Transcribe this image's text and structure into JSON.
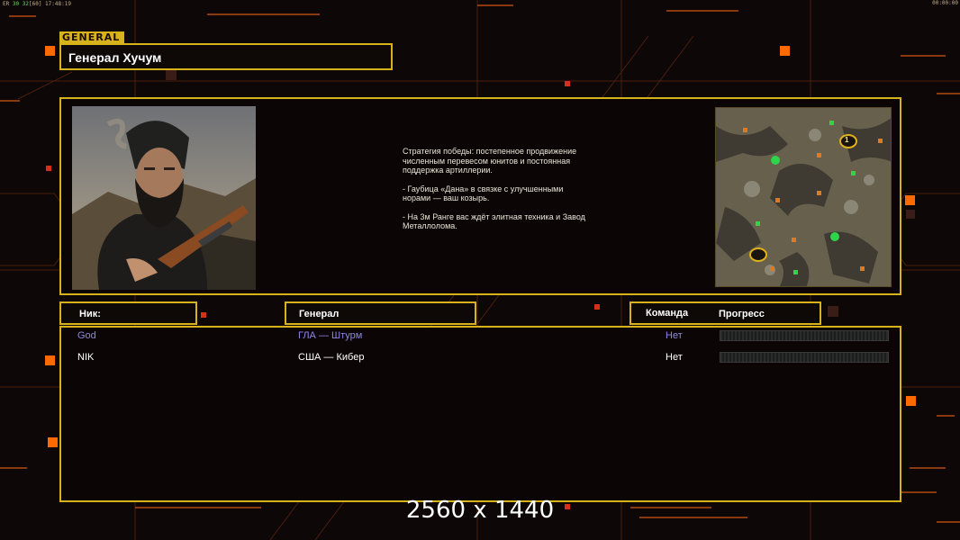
{
  "hud": {
    "fps_prefix": "ER",
    "fps_a": "30",
    "fps_b": "32",
    "fps_c": "60",
    "clock": "17:48:19",
    "timer": "00:00:00"
  },
  "header": {
    "tag": "GENERAL",
    "title": "Генерал Хучум"
  },
  "briefing": {
    "strategy": "Стратегия победы: постепенное продвижение численным перевесом юнитов и постоянная поддержка артиллерии.",
    "tip1": "- Гаубица «Дана» в связке с улучшенными норами — ваш козырь.",
    "tip2": "- На 3м Ранге вас ждёт элитная техника и Завод Металлолома."
  },
  "columns": {
    "nick": "Ник:",
    "general": "Генерал",
    "team": "Команда",
    "progress": "Прогресс"
  },
  "players": [
    {
      "nick": "God",
      "general": "ГЛА — Штурм",
      "team": "Нет",
      "progress": 0,
      "color": "#8f86e6"
    },
    {
      "nick": "NIK",
      "general": "США — Кибер",
      "team": "Нет",
      "progress": 0,
      "color": "#ffffff"
    }
  ],
  "minimap": {
    "start_marker": "1"
  },
  "overlay": {
    "resolution": "2560 x 1440"
  },
  "colors": {
    "accent": "#d7b21a",
    "orange": "#ff7a00",
    "background": "#0d0707"
  }
}
